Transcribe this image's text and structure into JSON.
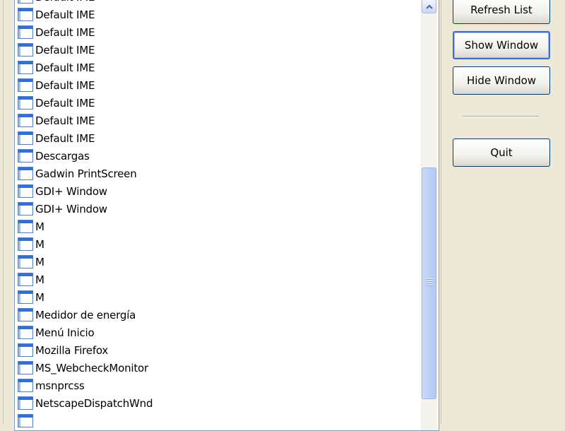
{
  "window_list": {
    "items": [
      {
        "label": "Default IME",
        "icon": "window-icon"
      },
      {
        "label": "Default IME",
        "icon": "window-icon"
      },
      {
        "label": "Default IME",
        "icon": "window-icon"
      },
      {
        "label": "Default IME",
        "icon": "window-icon"
      },
      {
        "label": "Default IME",
        "icon": "window-icon"
      },
      {
        "label": "Default IME",
        "icon": "window-icon"
      },
      {
        "label": "Default IME",
        "icon": "window-icon"
      },
      {
        "label": "Default IME",
        "icon": "window-icon"
      },
      {
        "label": "Default IME",
        "icon": "window-icon"
      },
      {
        "label": "Descargas",
        "icon": "window-icon"
      },
      {
        "label": "Gadwin PrintScreen",
        "icon": "window-icon"
      },
      {
        "label": "GDI+ Window",
        "icon": "window-icon"
      },
      {
        "label": "GDI+ Window",
        "icon": "window-icon"
      },
      {
        "label": "M",
        "icon": "window-icon"
      },
      {
        "label": "M",
        "icon": "window-icon"
      },
      {
        "label": "M",
        "icon": "window-icon"
      },
      {
        "label": "M",
        "icon": "window-icon"
      },
      {
        "label": "M",
        "icon": "window-icon"
      },
      {
        "label": "Medidor de energía",
        "icon": "window-icon"
      },
      {
        "label": "Menú Inicio",
        "icon": "window-icon"
      },
      {
        "label": "Mozilla Firefox",
        "icon": "window-icon"
      },
      {
        "label": "MS_WebcheckMonitor",
        "icon": "window-icon"
      },
      {
        "label": "msnprcss",
        "icon": "window-icon"
      },
      {
        "label": "NetscapeDispatchWnd",
        "icon": "window-icon"
      },
      {
        "label": "",
        "icon": "window-icon"
      }
    ]
  },
  "buttons": {
    "refresh_list": "Refresh List",
    "show_window": "Show Window",
    "hide_window": "Hide Window",
    "quit": "Quit"
  },
  "colors": {
    "panel_background": "#ece9d8",
    "list_background": "#ffffff",
    "scrollbar_accent": "#bdd0f7",
    "button_border": "#003c74"
  }
}
